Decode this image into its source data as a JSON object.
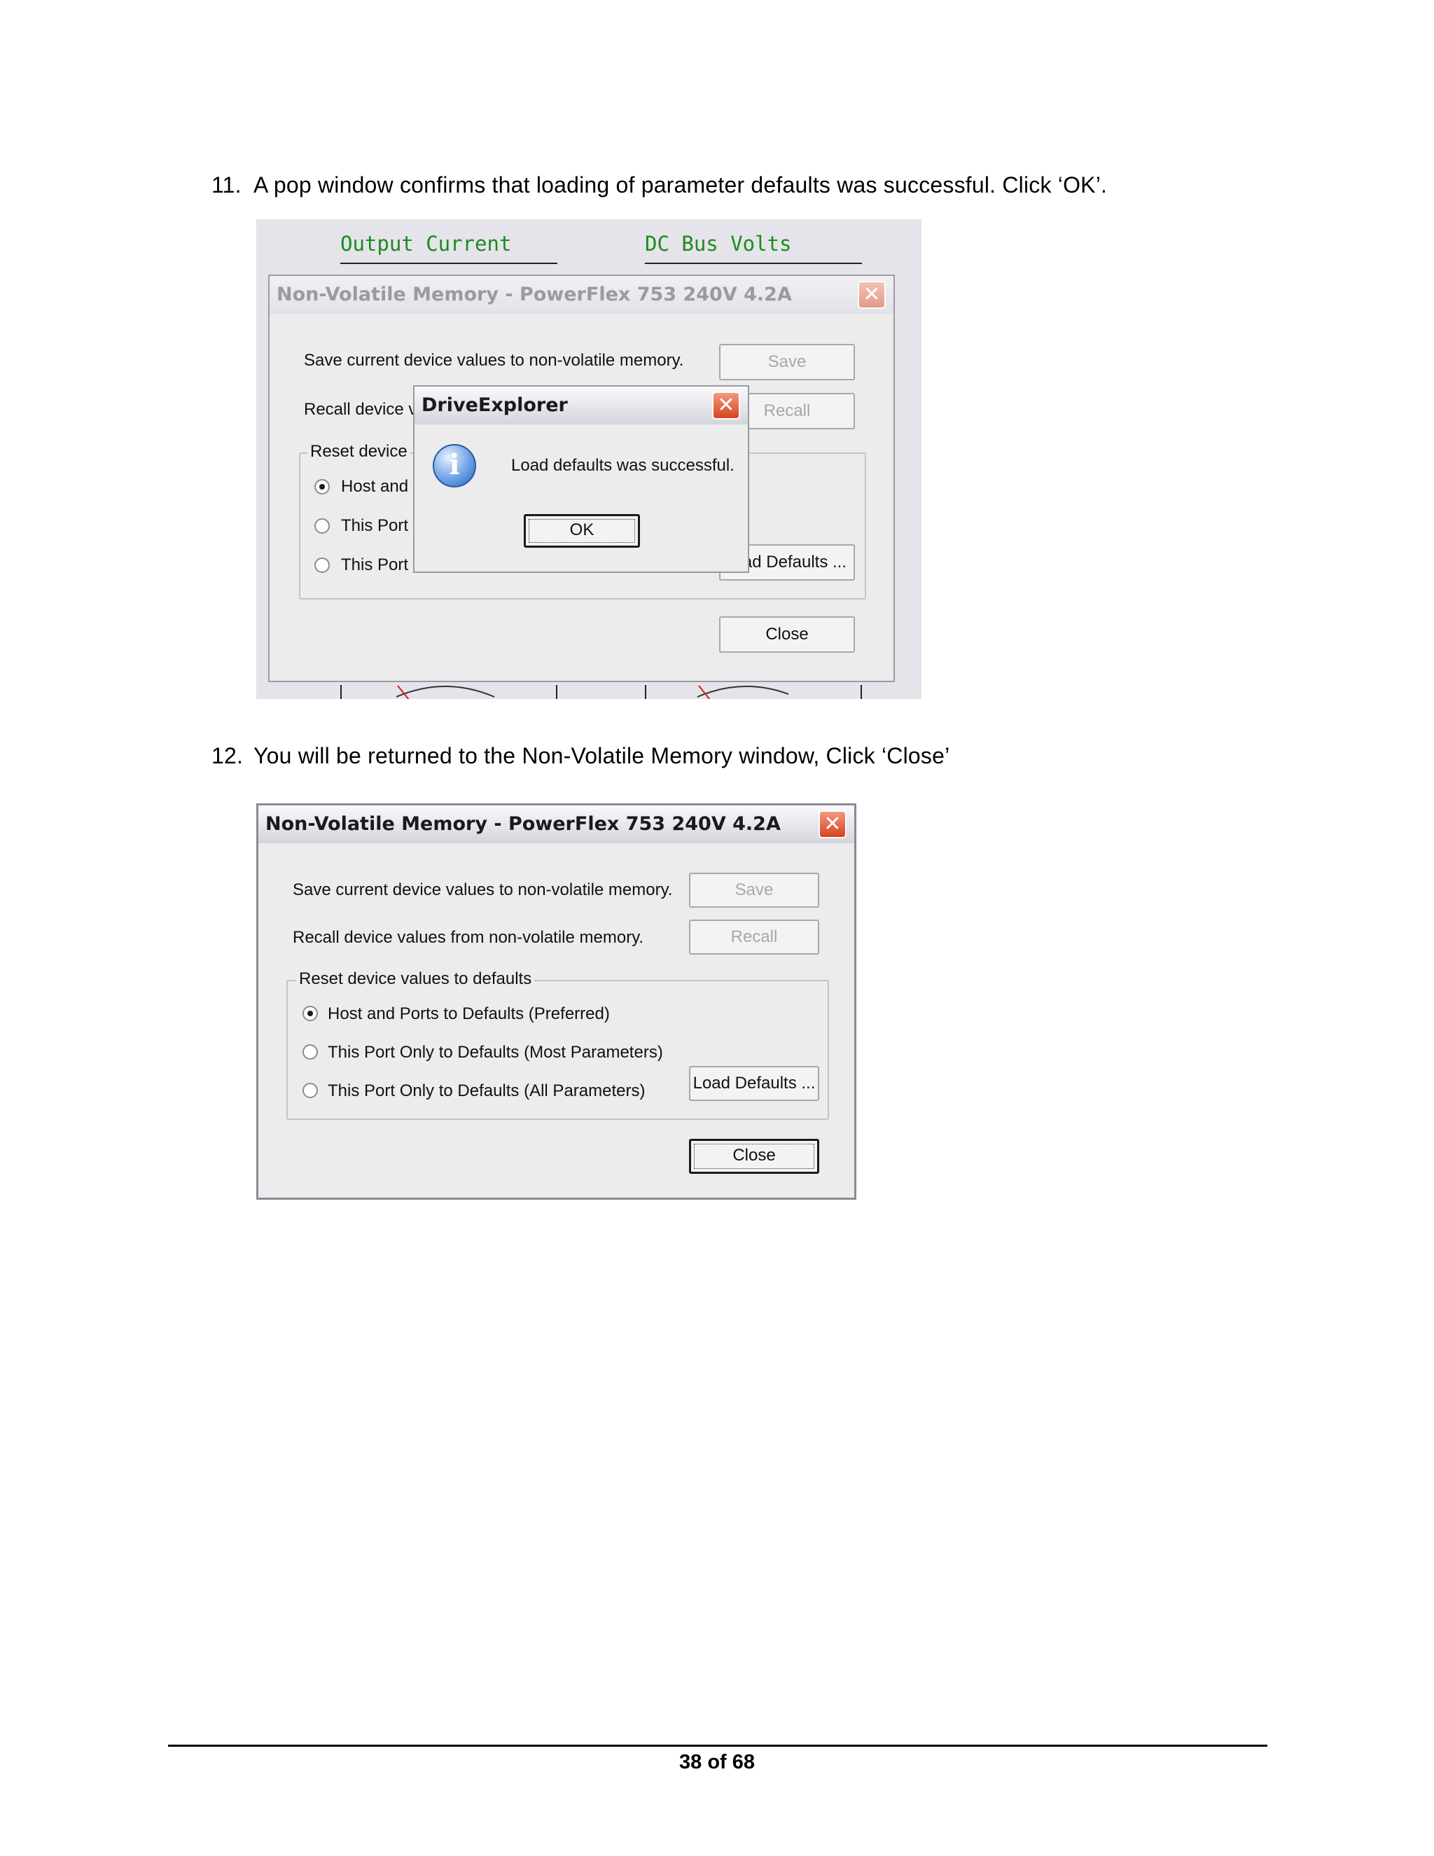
{
  "steps": [
    {
      "number": "11.",
      "text": "A pop window confirms that loading of parameter defaults was successful. Click ‘OK’."
    },
    {
      "number": "12.",
      "text": "You will be returned to the Non-Volatile Memory window, Click ‘Close’"
    }
  ],
  "gauges": {
    "left_title": "Output Current",
    "right_title": "DC Bus Volts"
  },
  "nvm_dialog": {
    "title": "Non-Volatile Memory - PowerFlex 753   240V    4.2A",
    "close_glyph": "✕",
    "save_label": "Save current device values to non-volatile memory.",
    "save_button": "Save",
    "recall_label": "Recall device values from non-volatile memory.",
    "recall_button": "Recall",
    "group_title": "Reset device values to defaults",
    "options": [
      "Host and Ports to Defaults (Preferred)",
      "This Port Only to Defaults (Most Parameters)",
      "This Port Only to Defaults (All Parameters)"
    ],
    "selected_option": 0,
    "load_defaults_button": "Load Defaults ...",
    "close_button": "Close"
  },
  "shot1_partial": {
    "recall_label": "Recall device v",
    "group_title": "Reset device",
    "option_1": "Host and",
    "option_2": "This Port",
    "option_3": "This Port",
    "load_defaults_button": "ad Defaults ..."
  },
  "info_dialog": {
    "title": "DriveExplorer",
    "close_glyph": "✕",
    "icon_glyph": "i",
    "message": "Load defaults was successful.",
    "ok_button": "OK"
  },
  "footer": {
    "page_label": "38 of 68"
  }
}
